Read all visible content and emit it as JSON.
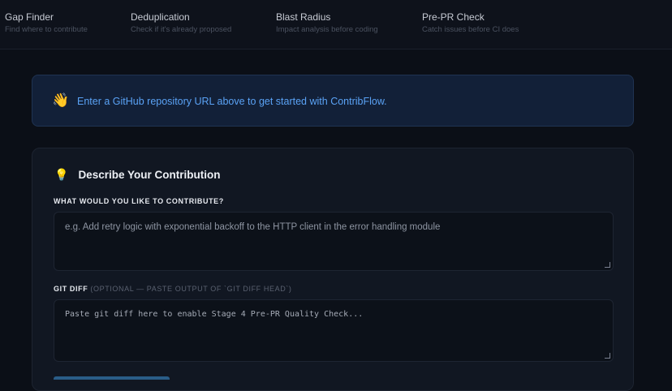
{
  "tabs": [
    {
      "title": "Gap Finder",
      "subtitle": "Find where to contribute"
    },
    {
      "title": "Deduplication",
      "subtitle": "Check if it's already proposed"
    },
    {
      "title": "Blast Radius",
      "subtitle": "Impact analysis before coding"
    },
    {
      "title": "Pre-PR Check",
      "subtitle": "Catch issues before CI does"
    }
  ],
  "banner": {
    "icon": "👋",
    "text": "Enter a GitHub repository URL above to get started with ContribFlow."
  },
  "contribution": {
    "icon": "💡",
    "title": "Describe Your Contribution",
    "description_label": "WHAT WOULD YOU LIKE TO CONTRIBUTE?",
    "description_placeholder": "e.g. Add retry logic with exponential backoff to the HTTP client in the error handling module",
    "diff_label": "GIT DIFF",
    "diff_note": "(OPTIONAL — PASTE OUTPUT OF `GIT DIFF HEAD`)",
    "diff_placeholder": "Paste git diff here to enable Stage 4 Pre-PR Quality Check..."
  },
  "colors": {
    "background": "#0b0f17",
    "accent": "#5aa2f5",
    "banner_bg": "#122038",
    "card_bg": "#111722"
  }
}
